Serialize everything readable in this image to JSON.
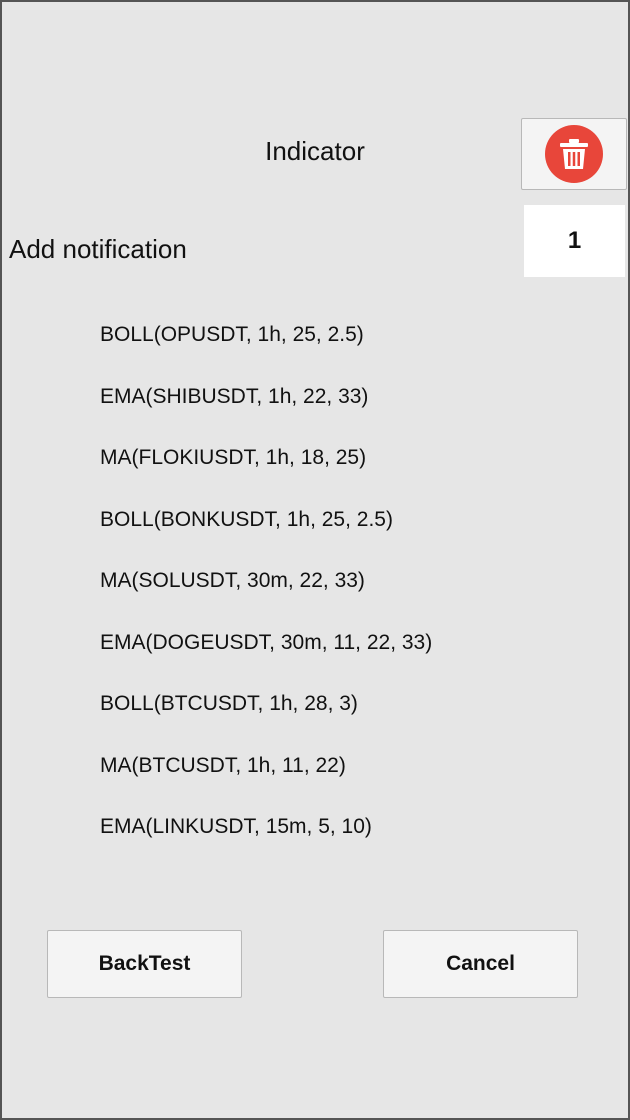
{
  "header": {
    "title": "Indicator",
    "delete_icon": "trash-icon",
    "delete_color": "#e8463a"
  },
  "notification": {
    "label": "Add notification",
    "count": "1"
  },
  "indicators": [
    "BOLL(OPUSDT, 1h, 25, 2.5)",
    "EMA(SHIBUSDT, 1h, 22, 33)",
    "MA(FLOKIUSDT, 1h, 18, 25)",
    "BOLL(BONKUSDT, 1h, 25, 2.5)",
    "MA(SOLUSDT, 30m, 22, 33)",
    "EMA(DOGEUSDT, 30m, 11, 22, 33)",
    "BOLL(BTCUSDT, 1h, 28, 3)",
    "MA(BTCUSDT, 1h, 11, 22)",
    "EMA(LINKUSDT, 15m, 5, 10)"
  ],
  "buttons": {
    "backtest": "BackTest",
    "cancel": "Cancel"
  }
}
